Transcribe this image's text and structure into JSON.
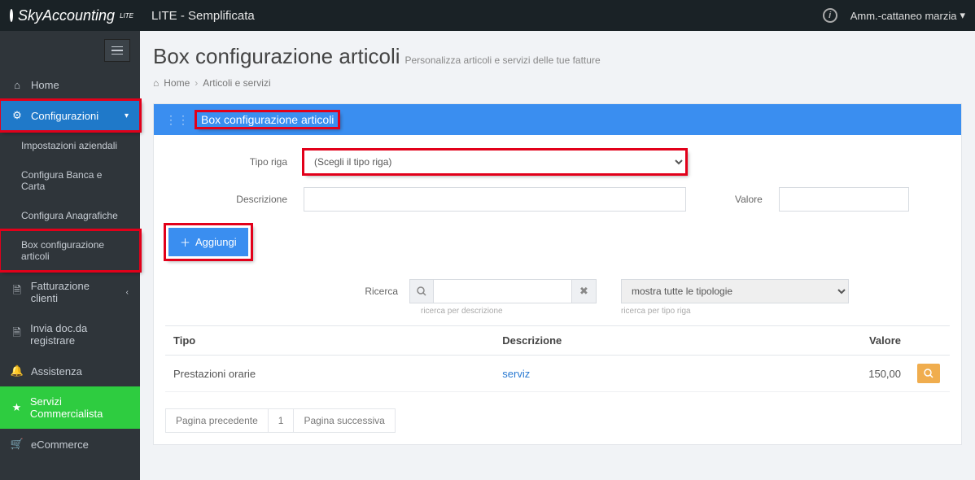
{
  "app": {
    "name": "SkyAccounting",
    "sub": "LITE",
    "edition": "LITE - Semplificata"
  },
  "user": {
    "display": "Amm.-cattaneo marzia"
  },
  "sidebar": {
    "home": "Home",
    "configurazioni": "Configurazioni",
    "sub1": "Impostazioni aziendali",
    "sub2": "Configura Banca e Carta",
    "sub3": "Configura Anagrafiche",
    "sub4": "Box configurazione articoli",
    "fatturazione": "Fatturazione clienti",
    "invia": "Invia doc.da registrare",
    "assistenza": "Assistenza",
    "commercialista": "Servizi Commercialista",
    "ecommerce": "eCommerce"
  },
  "page": {
    "title": "Box configurazione articoli",
    "subtitle": "Personalizza articoli e servizi delle tue fatture"
  },
  "breadcrumb": {
    "home": "Home",
    "current": "Articoli e servizi"
  },
  "panel": {
    "title": "Box configurazione articoli"
  },
  "form": {
    "tipo_riga_label": "Tipo riga",
    "tipo_riga_placeholder": "(Scegli il tipo riga)",
    "descrizione_label": "Descrizione",
    "valore_label": "Valore",
    "aggiungi": "Aggiungi"
  },
  "search": {
    "label": "Ricerca",
    "hint": "ricerca per descrizione",
    "filter_selected": "mostra tutte le tipologie",
    "hint2": "ricerca per tipo riga"
  },
  "table": {
    "col_tipo": "Tipo",
    "col_descrizione": "Descrizione",
    "col_valore": "Valore",
    "rows": [
      {
        "tipo": "Prestazioni orarie",
        "descrizione": "serviz",
        "valore": "150,00"
      }
    ]
  },
  "pager": {
    "prev": "Pagina precedente",
    "page": "1",
    "next": "Pagina successiva"
  }
}
